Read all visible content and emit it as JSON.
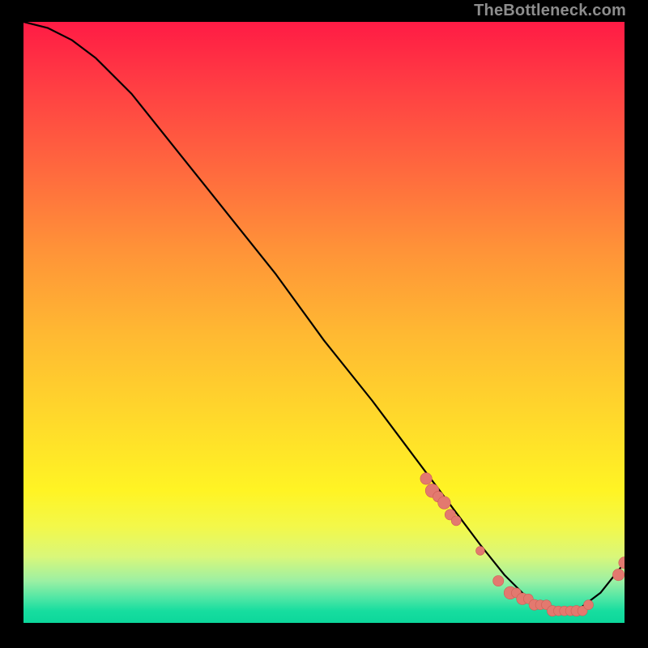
{
  "watermark": "TheBottleneck.com",
  "chart_data": {
    "type": "line",
    "title": "",
    "xlabel": "",
    "ylabel": "",
    "xlim": [
      0,
      100
    ],
    "ylim": [
      0,
      100
    ],
    "series": [
      {
        "name": "bottleneck-curve",
        "x": [
          0,
          4,
          8,
          12,
          18,
          26,
          34,
          42,
          50,
          58,
          64,
          70,
          76,
          80,
          84,
          88,
          92,
          96,
          100
        ],
        "values": [
          100,
          99,
          97,
          94,
          88,
          78,
          68,
          58,
          47,
          37,
          29,
          21,
          13,
          8,
          4,
          2,
          2,
          5,
          10
        ]
      }
    ],
    "highlight_clusters": [
      {
        "name": "mid-slope-cluster",
        "points": [
          {
            "x": 67,
            "y": 24,
            "r": 1.2
          },
          {
            "x": 68,
            "y": 22,
            "r": 1.4
          },
          {
            "x": 69,
            "y": 21,
            "r": 1.1
          },
          {
            "x": 70,
            "y": 20,
            "r": 1.3
          },
          {
            "x": 71,
            "y": 18,
            "r": 1.1
          },
          {
            "x": 72,
            "y": 17,
            "r": 1.0
          }
        ]
      },
      {
        "name": "single-dot",
        "points": [
          {
            "x": 76,
            "y": 12,
            "r": 0.9
          }
        ]
      },
      {
        "name": "valley-cluster",
        "points": [
          {
            "x": 79,
            "y": 7,
            "r": 1.1
          },
          {
            "x": 81,
            "y": 5,
            "r": 1.3
          },
          {
            "x": 82,
            "y": 5,
            "r": 1.0
          },
          {
            "x": 83,
            "y": 4,
            "r": 1.2
          },
          {
            "x": 84,
            "y": 4,
            "r": 1.0
          },
          {
            "x": 85,
            "y": 3,
            "r": 1.1
          },
          {
            "x": 86,
            "y": 3,
            "r": 1.0
          },
          {
            "x": 87,
            "y": 3,
            "r": 1.0
          },
          {
            "x": 88,
            "y": 2,
            "r": 1.1
          },
          {
            "x": 89,
            "y": 2,
            "r": 1.0
          },
          {
            "x": 90,
            "y": 2,
            "r": 1.0
          },
          {
            "x": 91,
            "y": 2,
            "r": 1.0
          },
          {
            "x": 92,
            "y": 2,
            "r": 1.1
          },
          {
            "x": 93,
            "y": 2,
            "r": 1.0
          },
          {
            "x": 94,
            "y": 3,
            "r": 1.0
          }
        ]
      },
      {
        "name": "upturn-cluster",
        "points": [
          {
            "x": 99,
            "y": 8,
            "r": 1.2
          },
          {
            "x": 100,
            "y": 10,
            "r": 1.2
          }
        ]
      }
    ],
    "colors": {
      "curve": "#000000",
      "marker_fill": "#e3796f",
      "marker_stroke": "#cf5d56"
    }
  }
}
